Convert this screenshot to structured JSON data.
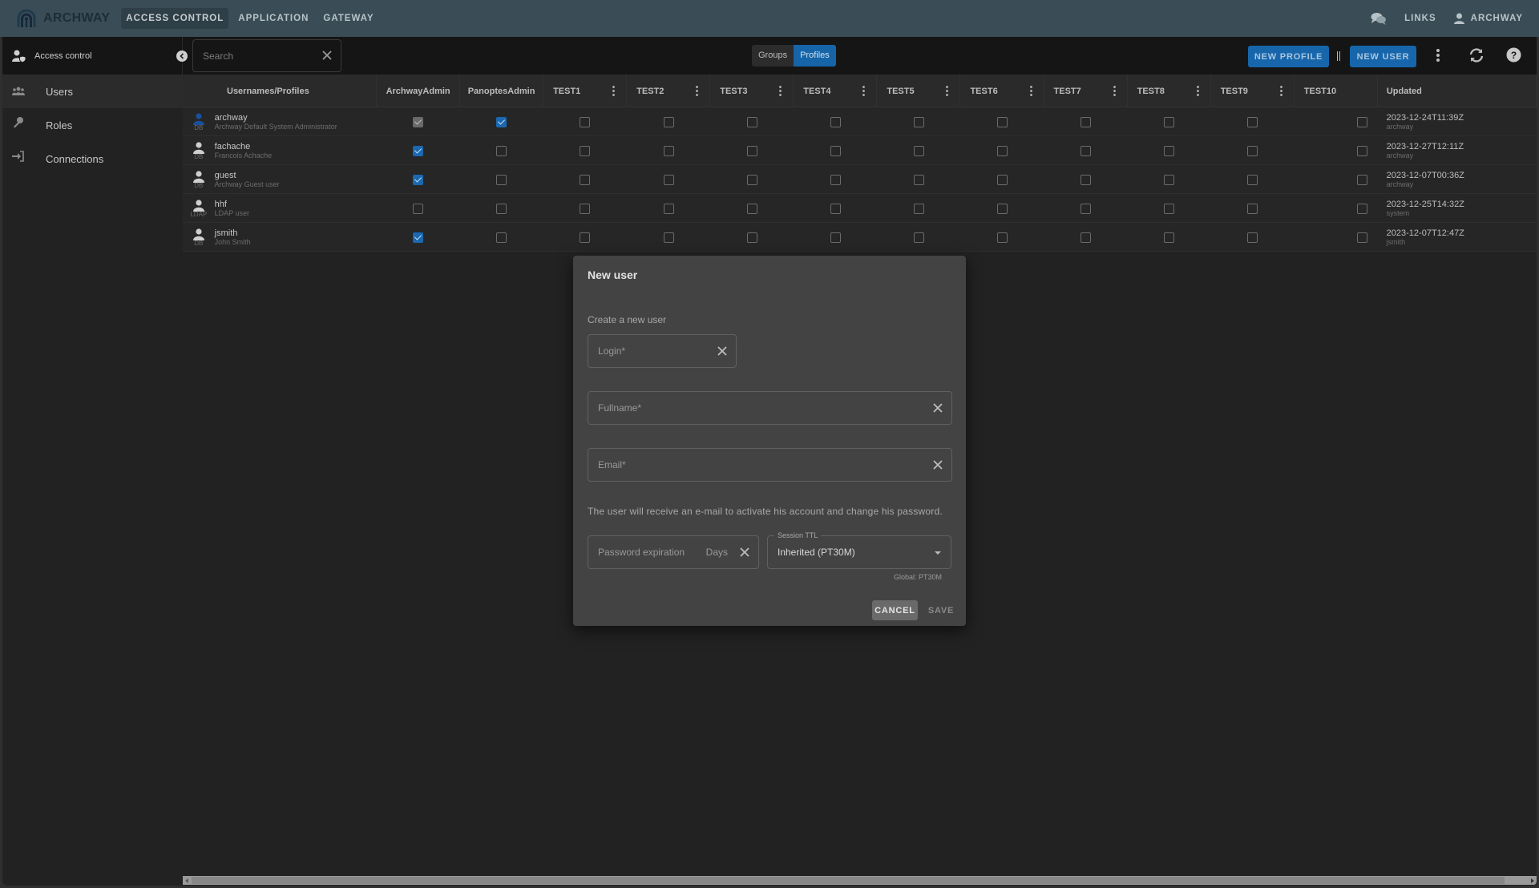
{
  "topbar": {
    "brand": "ARCHWAY",
    "nav": [
      "ACCESS CONTROL",
      "APPLICATION",
      "GATEWAY"
    ],
    "active_nav": "ACCESS CONTROL",
    "links_label": "LINKS",
    "user_label": "ARCHWAY",
    "icons": {
      "chat": "chat-bubbles-icon",
      "user": "user-icon"
    }
  },
  "toolbar": {
    "section_label": "Access control",
    "search_placeholder": "Search",
    "toggle": [
      "Groups",
      "Profiles"
    ],
    "toggle_active": "Profiles",
    "new_profile_label": "NEW PROFILE",
    "new_user_label": "NEW USER",
    "icons": [
      "more-vert-icon",
      "refresh-icon",
      "help-icon"
    ]
  },
  "sidebar": {
    "items": [
      {
        "label": "Users",
        "icon": "users-icon",
        "active": true
      },
      {
        "label": "Roles",
        "icon": "key-icon",
        "active": false
      },
      {
        "label": "Connections",
        "icon": "login-icon",
        "active": false
      }
    ]
  },
  "table": {
    "columns": [
      "Usernames/Profiles",
      "ArchwayAdmin",
      "PanoptesAdmin",
      "TEST1",
      "TEST2",
      "TEST3",
      "TEST4",
      "TEST5",
      "TEST6",
      "TEST7",
      "TEST8",
      "TEST9",
      "TEST10",
      "Updated"
    ],
    "rows": [
      {
        "username": "archway",
        "fullname": "Archway Default System Administrator",
        "source": "DB",
        "avatar_color": "#1a4f9c",
        "profiles": [
          "grey",
          "on",
          "off",
          "off",
          "off",
          "off",
          "off",
          "off",
          "off",
          "off",
          "off",
          "off"
        ],
        "updated": "2023-12-24T11:39Z",
        "updated_by": "archway"
      },
      {
        "username": "fachache",
        "fullname": "Francois Achache",
        "source": "DB",
        "avatar_color": "#cfcfcf",
        "profiles": [
          "on",
          "off",
          "off",
          "off",
          "off",
          "off",
          "off",
          "off",
          "off",
          "off",
          "off",
          "off"
        ],
        "updated": "2023-12-27T12:11Z",
        "updated_by": "archway"
      },
      {
        "username": "guest",
        "fullname": "Archway Guest user",
        "source": "DB",
        "avatar_color": "#cfcfcf",
        "profiles": [
          "on",
          "off",
          "off",
          "off",
          "off",
          "off",
          "off",
          "off",
          "off",
          "off",
          "off",
          "off"
        ],
        "updated": "2023-12-07T00:36Z",
        "updated_by": "archway"
      },
      {
        "username": "hhf",
        "fullname": "LDAP user",
        "source": "LDAP",
        "avatar_color": "#cfcfcf",
        "profiles": [
          "off",
          "off",
          "off",
          "off",
          "off",
          "off",
          "off",
          "off",
          "off",
          "off",
          "off",
          "off"
        ],
        "updated": "2023-12-25T14:32Z",
        "updated_by": "system"
      },
      {
        "username": "jsmith",
        "fullname": "John Smith",
        "source": "DB",
        "avatar_color": "#cfcfcf",
        "profiles": [
          "on",
          "off",
          "off",
          "off",
          "off",
          "off",
          "off",
          "off",
          "off",
          "off",
          "off",
          "off"
        ],
        "updated": "2023-12-07T12:47Z",
        "updated_by": "jsmith"
      }
    ]
  },
  "dialog": {
    "title": "New user",
    "subtitle": "Create a new user",
    "login_placeholder": "Login*",
    "fullname_placeholder": "Fullname*",
    "email_placeholder": "Email*",
    "info": "The user will receive an e-mail to activate his account and change his password.",
    "password_expiration_placeholder": "Password expiration",
    "password_expiration_unit": "Days",
    "session_ttl_label": "Session TTL",
    "session_ttl_value": "Inherited (PT30M)",
    "session_ttl_helper": "Global: PT30M",
    "cancel_label": "CANCEL",
    "save_label": "SAVE"
  },
  "colors": {
    "accent": "#1766ab",
    "topbar": "#3a4d56",
    "dialog": "#434343"
  }
}
